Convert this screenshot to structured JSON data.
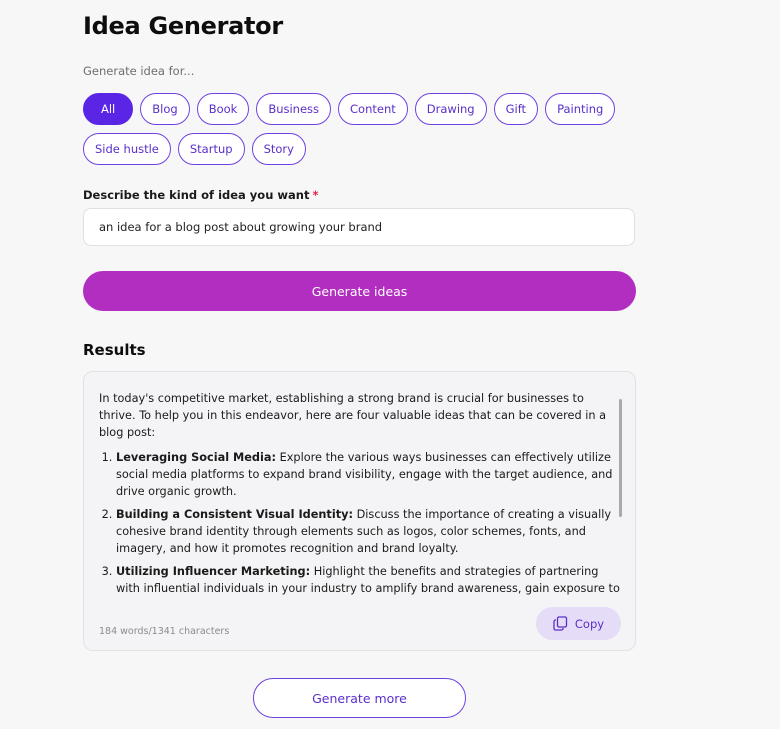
{
  "page": {
    "title": "Idea Generator",
    "generate_for_label": "Generate idea for..."
  },
  "categories": [
    "All",
    "Blog",
    "Book",
    "Business",
    "Content",
    "Drawing",
    "Gift",
    "Painting",
    "Side hustle",
    "Startup",
    "Story"
  ],
  "selected_category": "All",
  "description": {
    "label": "Describe the kind of idea you want",
    "required_marker": "*",
    "value": "an idea for a blog post about growing your brand"
  },
  "generate_button_label": "Generate ideas",
  "results": {
    "title": "Results",
    "intro": "In today's competitive market, establishing a strong brand is crucial for businesses to thrive. To help you in this endeavor, here are four valuable ideas that can be covered in a blog post:",
    "items": [
      {
        "heading": "Leveraging Social Media:",
        "text": " Explore the various ways businesses can effectively utilize social media platforms to expand brand visibility, engage with the target audience, and drive organic growth."
      },
      {
        "heading": "Building a Consistent Visual Identity:",
        "text": " Discuss the importance of creating a visually cohesive brand identity through elements such as logos, color schemes, fonts, and imagery, and how it promotes recognition and brand loyalty."
      },
      {
        "heading": "Utilizing Influencer Marketing:",
        "text": " Highlight the benefits and strategies of partnering with influential individuals in your industry to amplify brand awareness, gain exposure to new audiences, and establish credibility."
      }
    ],
    "count": "184 words/1341 characters",
    "copy_label": "Copy",
    "copy_icon": "copy-icon"
  },
  "generate_more_label": "Generate more",
  "colors": {
    "accent": "#5b25e6",
    "generate_button": "#b12ec0",
    "required": "#e0264a",
    "copy_bg": "#e5dcf8"
  }
}
